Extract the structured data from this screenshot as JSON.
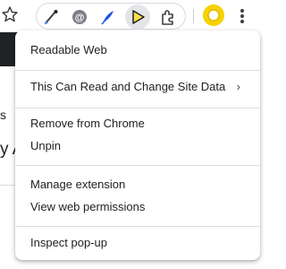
{
  "toolbar": {
    "bookmark_icon": "star-icon",
    "extensions": [
      {
        "name": "pen-extension-icon"
      },
      {
        "name": "at-extension-icon"
      },
      {
        "name": "feather-extension-icon"
      },
      {
        "name": "play-extension-icon",
        "active": true
      },
      {
        "name": "puzzle-icon"
      }
    ],
    "profile_icon": "profile-circle-icon",
    "menu_icon": "more-vert-icon",
    "accent_yellow": "#f6d200"
  },
  "background_page": {
    "fragment_1": "S",
    "fragment_2": "s",
    "fragment_3": "y A"
  },
  "context_menu": {
    "items": [
      {
        "label": "Readable Web",
        "group": 1
      },
      {
        "label": "This Can Read and Change Site Data",
        "group": 2,
        "submenu": "›"
      },
      {
        "label": "Remove from Chrome",
        "group": 3
      },
      {
        "label": "Unpin",
        "group": 3
      },
      {
        "label": "Manage extension",
        "group": 4
      },
      {
        "label": "View web permissions",
        "group": 4
      },
      {
        "label": "Inspect pop-up",
        "group": 5
      }
    ]
  }
}
